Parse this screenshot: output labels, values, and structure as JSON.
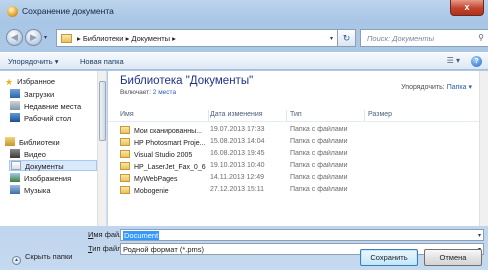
{
  "window": {
    "title": "Сохранение документа",
    "close_label": "x"
  },
  "address": {
    "crumbs": "▸ Библиотеки ▸ Документы ▸",
    "search_placeholder": "Поиск: Документы"
  },
  "toolbar": {
    "organize": "Упорядочить ▾",
    "new_folder": "Новая папка",
    "help": "?"
  },
  "nav": {
    "items": [
      {
        "label": "Избранное",
        "icon": "star-icon"
      },
      {
        "label": "Загрузки",
        "icon": "downloads-icon"
      },
      {
        "label": "Недавние места",
        "icon": "recent-places-icon"
      },
      {
        "label": "Рабочий стол",
        "icon": "desktop-icon"
      },
      {
        "label": "Библиотеки",
        "icon": "libraries-icon"
      },
      {
        "label": "Видео",
        "icon": "video-icon"
      },
      {
        "label": "Документы",
        "icon": "documents-icon",
        "selected": true
      },
      {
        "label": "Изображения",
        "icon": "images-icon"
      },
      {
        "label": "Музыка",
        "icon": "music-icon"
      }
    ]
  },
  "library": {
    "title": "Библиотека \"Документы\"",
    "includes_label": "Включает:",
    "includes_link": "2 места",
    "arrange_label": "Упорядочить:",
    "arrange_value": "Папка ▾"
  },
  "columns": {
    "name": "Имя",
    "date": "Дата изменения",
    "type": "Тип",
    "size": "Размер"
  },
  "files": [
    {
      "name": "Мои сканированны...",
      "date": "19.07.2013 17:33",
      "type": "Папка с файлами"
    },
    {
      "name": "HP Photosmart Proje...",
      "date": "15.08.2013 14:04",
      "type": "Папка с файлами"
    },
    {
      "name": "Visual Studio 2005",
      "date": "16.08.2013 19:45",
      "type": "Папка с файлами"
    },
    {
      "name": "HP_LaserJet_Fax_0_6",
      "date": "19.10.2013 10:40",
      "type": "Папка с файлами"
    },
    {
      "name": "MyWebPages",
      "date": "14.11.2013 12:49",
      "type": "Папка с файлами"
    },
    {
      "name": "Mobogenie",
      "date": "27.12.2013 15:11",
      "type": "Папка с файлами"
    }
  ],
  "form": {
    "filename_label_u": "И",
    "filename_label_rest": "мя файла:",
    "filename_value": "Document",
    "filetype_label_u": "Т",
    "filetype_label_rest": "ип файла:",
    "filetype_value": "Родной формат (*.pms)"
  },
  "footer": {
    "hide_folders": "Скрыть папки",
    "save": "Сохранить",
    "cancel": "Отмена"
  }
}
